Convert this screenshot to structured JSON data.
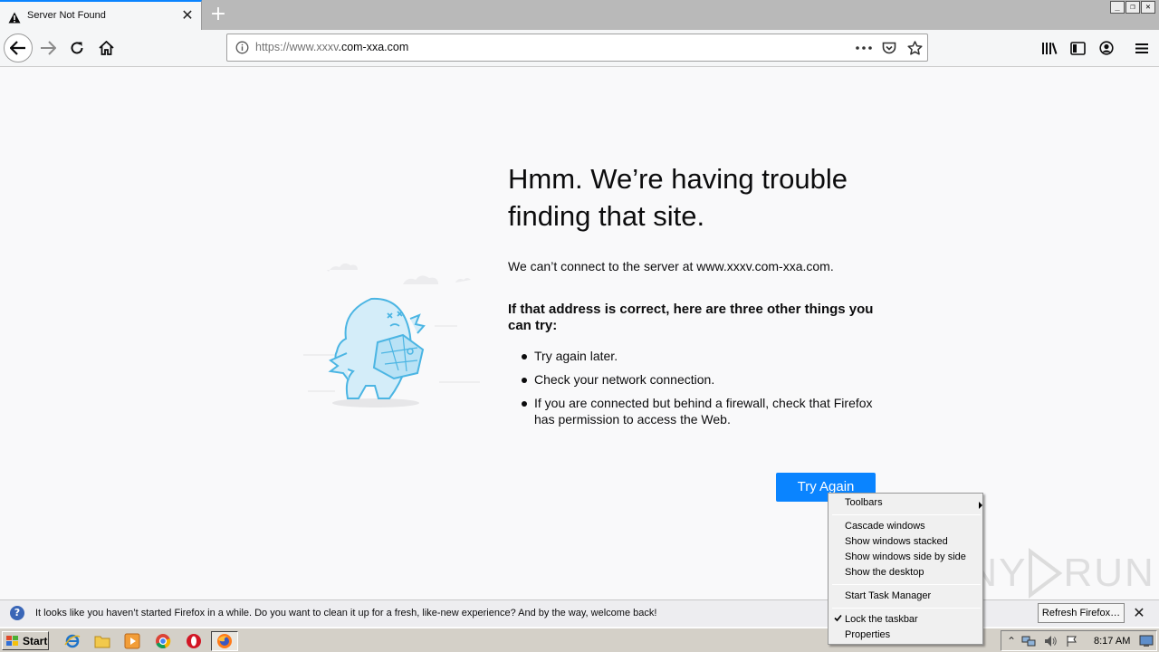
{
  "browser": {
    "tab_title": "Server Not Found",
    "url_prefix": "https://www.",
    "url_dim": "xxxv",
    "url_main": ".com-xxa.com",
    "window_controls": [
      "minimize",
      "restore",
      "close"
    ]
  },
  "error_page": {
    "title": "Hmm. We’re having trouble finding that site.",
    "description": "We can’t connect to the server at www.xxxv.com-xxa.com.",
    "subheading": "If that address is correct, here are three other things you can try:",
    "tips": [
      "Try again later.",
      "Check your network connection.",
      "If you are connected but behind a firewall, check that Firefox has permission to access the Web."
    ],
    "try_again_label": "Try Again"
  },
  "notification": {
    "text": "It looks like you haven’t started Firefox in a while. Do you want to clean it up for a fresh, like-new experience? And by the way, welcome back!",
    "button_label": "Refresh Firefox…"
  },
  "context_menu": {
    "items": [
      "Toolbars",
      "Cascade windows",
      "Show windows stacked",
      "Show windows side by side",
      "Show the desktop",
      "Start Task Manager",
      "Lock the taskbar",
      "Properties"
    ]
  },
  "taskbar": {
    "start_label": "Start",
    "clock": "8:17 AM",
    "pinned_icons": [
      "internet-explorer-icon",
      "folder-icon",
      "media-player-icon",
      "chrome-icon",
      "opera-icon",
      "firefox-icon"
    ]
  },
  "watermark": {
    "text_left": "ANY",
    "text_right": "RUN"
  },
  "colors": {
    "accent": "#0a84ff",
    "mascot": "#4bb5e3"
  }
}
